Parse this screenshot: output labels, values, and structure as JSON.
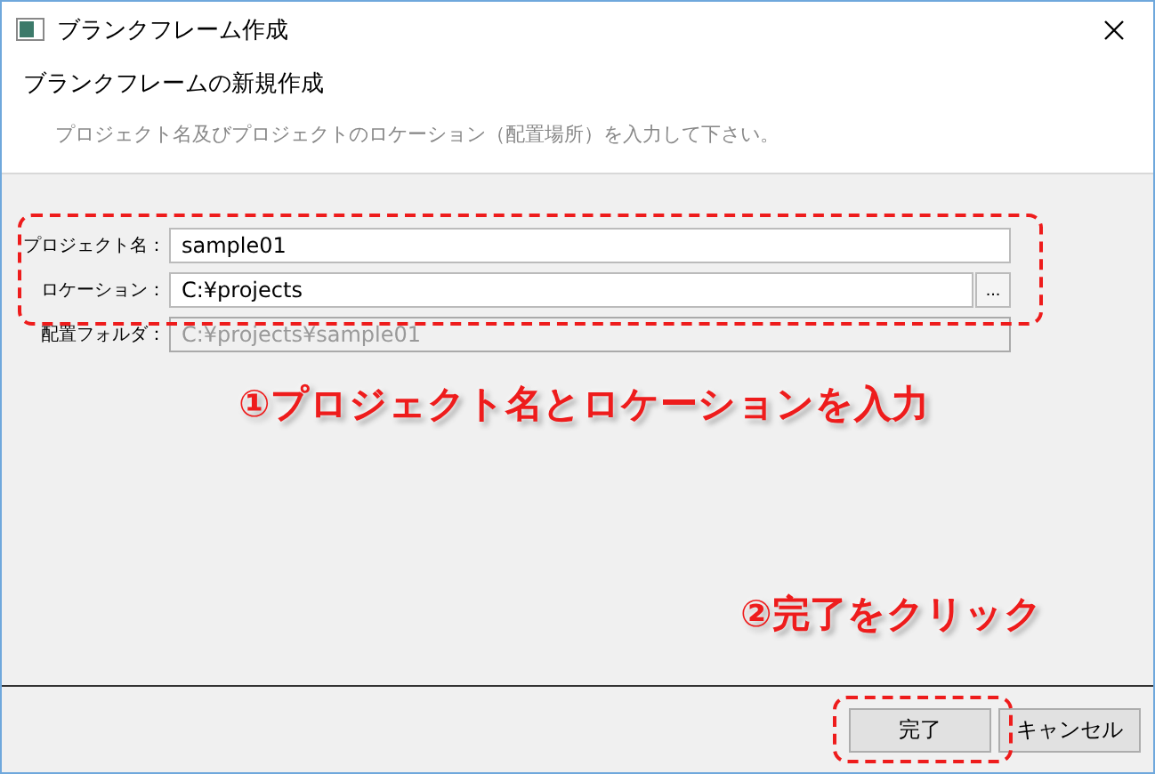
{
  "window": {
    "title": "ブランクフレーム作成"
  },
  "header": {
    "title": "ブランクフレームの新規作成",
    "description": "プロジェクト名及びプロジェクトのロケーション（配置場所）を入力して下さい。"
  },
  "fields": [
    {
      "label": "プロジェクト名：",
      "value": "sample01",
      "disabled": false
    },
    {
      "label": "ロケーション：",
      "value": "C:¥projects",
      "disabled": false,
      "browse": "..."
    },
    {
      "label": "配置フォルダ：",
      "value": "C:¥projects¥sample01",
      "disabled": true
    }
  ],
  "annotations": [
    {
      "text": "①プロジェクト名とロケーションを入力"
    },
    {
      "text": "②完了をクリック"
    }
  ],
  "buttons": [
    {
      "label": "完了"
    },
    {
      "label": "キャンセル"
    }
  ]
}
